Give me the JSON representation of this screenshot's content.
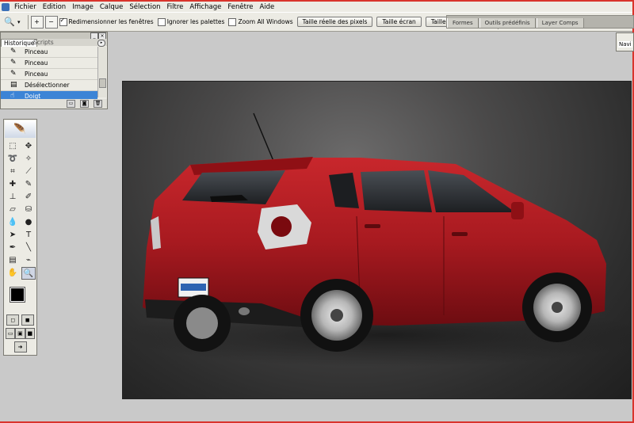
{
  "menubar": {
    "items": [
      "Fichier",
      "Edition",
      "Image",
      "Calque",
      "Sélection",
      "Filtre",
      "Affichage",
      "Fenêtre",
      "Aide"
    ]
  },
  "options": {
    "resize_windows_label": "Redimensionner les fenêtres",
    "resize_windows_checked": true,
    "ignore_palettes_label": "Ignorer les palettes",
    "ignore_palettes_checked": false,
    "zoom_all_label": "Zoom All Windows",
    "zoom_all_checked": false,
    "actual_pixels_button": "Taille réelle des pixels",
    "fit_screen_button": "Taille écran",
    "print_size_button": "Taille d'impression"
  },
  "palette_well": {
    "tabs": [
      "Formes",
      "Outils prédéfinis",
      "Layer Comps"
    ]
  },
  "history_palette": {
    "active_tab": "Historique",
    "inactive_tab": "Scripts",
    "rows": [
      {
        "label": "Pinceau",
        "icon": "brush-icon",
        "selected": false
      },
      {
        "label": "Pinceau",
        "icon": "brush-icon",
        "selected": false
      },
      {
        "label": "Pinceau",
        "icon": "brush-icon",
        "selected": false
      },
      {
        "label": "Désélectionner",
        "icon": "document-icon",
        "selected": false
      },
      {
        "label": "Doigt",
        "icon": "smudge-icon",
        "selected": true
      }
    ]
  },
  "navigator": {
    "label": "Navi"
  },
  "tools": {
    "foreground_color": "#000000",
    "background_color": "#000000",
    "active_tool": "zoom-tool"
  },
  "colors": {
    "accent_selected": "#3c84d6",
    "window_frame": "#d9342c",
    "chrome": "#ecebe4"
  }
}
